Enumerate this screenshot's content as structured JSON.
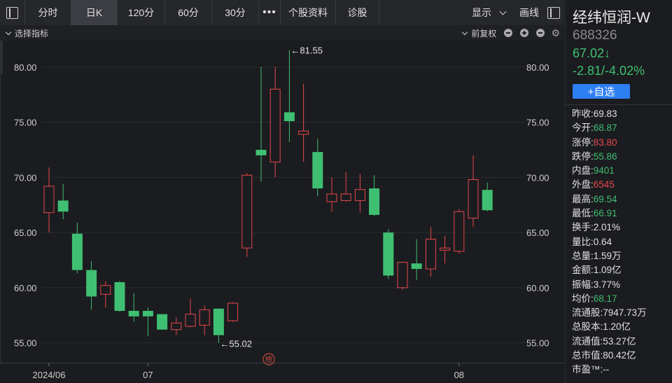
{
  "toolbar": {
    "tabs": [
      {
        "label": "分时",
        "active": false
      },
      {
        "label": "日K",
        "active": true
      },
      {
        "label": "120分",
        "active": false
      },
      {
        "label": "60分",
        "active": false
      },
      {
        "label": "30分",
        "active": false
      },
      {
        "label": "•••",
        "active": false
      },
      {
        "label": "个股资料",
        "active": false
      },
      {
        "label": "诊股",
        "active": false
      }
    ],
    "display_label": "显示",
    "draw_label": "画线"
  },
  "subbar": {
    "indicator_label": "选择指标",
    "adjust_label": "前复权"
  },
  "stock": {
    "name": "经纬恒润-W",
    "code": "688326",
    "price": "67.02↓",
    "change": "-2.81/-4.02%",
    "watch_label": "+自选",
    "stats": [
      {
        "label": "昨收:",
        "value": "69.83",
        "color": ""
      },
      {
        "label": "今开:",
        "value": "68.87",
        "color": "green"
      },
      {
        "label": "涨停:",
        "value": "83.80",
        "color": "red"
      },
      {
        "label": "跌停:",
        "value": "55.86",
        "color": "green"
      },
      {
        "label": "内盘:",
        "value": "9401",
        "color": "green"
      },
      {
        "label": "外盘:",
        "value": "6545",
        "color": "red"
      },
      {
        "label": "最高:",
        "value": "69.54",
        "color": "green"
      },
      {
        "label": "最低:",
        "value": "66.91",
        "color": "green"
      },
      {
        "label": "换手:",
        "value": "2.01%",
        "color": ""
      },
      {
        "label": "量比:",
        "value": "0.64",
        "color": ""
      },
      {
        "label": "总量:",
        "value": "1.59万",
        "color": ""
      },
      {
        "label": "金额:",
        "value": "1.09亿",
        "color": ""
      },
      {
        "label": "振幅:",
        "value": "3.77%",
        "color": ""
      },
      {
        "label": "均价:",
        "value": "68.17",
        "color": "green"
      },
      {
        "label": "流通股:",
        "value": "7947.73万",
        "color": ""
      },
      {
        "label": "总股本:",
        "value": "1.20亿",
        "color": ""
      },
      {
        "label": "流通值:",
        "value": "53.27亿",
        "color": ""
      },
      {
        "label": "总市值:",
        "value": "80.42亿",
        "color": ""
      },
      {
        "label": "市盈™:",
        "value": "--",
        "color": ""
      }
    ]
  },
  "colors": {
    "up": "#e5484d",
    "down": "#3fbf72",
    "axis_text": "#cfcfcf",
    "grid": "#2a2b2f",
    "accent": "#2d7ff2"
  },
  "chart_data": {
    "type": "candlestick",
    "y_ticks": [
      55,
      60,
      65,
      70,
      75,
      80
    ],
    "y_tick_labels": [
      "55.00",
      "60.00",
      "65.00",
      "70.00",
      "75.00",
      "80.00"
    ],
    "ylim": [
      53.2,
      82.4
    ],
    "x_labels": [
      {
        "label": "2024/06",
        "index": 0
      },
      {
        "label": "07",
        "index": 7
      },
      {
        "label": "08",
        "index": 29
      }
    ],
    "annotations": {
      "high": "←81.55",
      "low": "←55.02"
    },
    "badge": "榜",
    "candles": [
      {
        "o": 66.8,
        "h": 70.9,
        "l": 65.0,
        "c": 69.2
      },
      {
        "o": 67.9,
        "h": 69.4,
        "l": 66.2,
        "c": 66.9
      },
      {
        "o": 64.9,
        "h": 65.9,
        "l": 61.3,
        "c": 61.6
      },
      {
        "o": 61.6,
        "h": 62.4,
        "l": 58.0,
        "c": 59.2
      },
      {
        "o": 59.4,
        "h": 60.6,
        "l": 58.2,
        "c": 60.2
      },
      {
        "o": 60.5,
        "h": 60.6,
        "l": 57.8,
        "c": 57.9
      },
      {
        "o": 57.9,
        "h": 59.5,
        "l": 56.9,
        "c": 57.4
      },
      {
        "o": 57.9,
        "h": 58.2,
        "l": 55.6,
        "c": 57.4
      },
      {
        "o": 57.6,
        "h": 57.6,
        "l": 56.2,
        "c": 56.2
      },
      {
        "o": 56.2,
        "h": 57.3,
        "l": 55.7,
        "c": 56.8
      },
      {
        "o": 56.5,
        "h": 59.0,
        "l": 56.4,
        "c": 57.6
      },
      {
        "o": 56.6,
        "h": 58.4,
        "l": 55.7,
        "c": 58.0
      },
      {
        "o": 58.1,
        "h": 58.1,
        "l": 55.0,
        "c": 55.7
      },
      {
        "o": 57.0,
        "h": 58.7,
        "l": 56.9,
        "c": 58.6
      },
      {
        "o": 63.6,
        "h": 70.4,
        "l": 62.8,
        "c": 70.2
      },
      {
        "o": 72.5,
        "h": 80.0,
        "l": 69.6,
        "c": 72.0
      },
      {
        "o": 71.4,
        "h": 80.0,
        "l": 70.0,
        "c": 78.0
      },
      {
        "o": 75.9,
        "h": 81.55,
        "l": 73.2,
        "c": 75.1
      },
      {
        "o": 73.9,
        "h": 78.5,
        "l": 71.4,
        "c": 74.2
      },
      {
        "o": 72.3,
        "h": 73.5,
        "l": 68.3,
        "c": 69.0
      },
      {
        "o": 67.8,
        "h": 70.0,
        "l": 66.9,
        "c": 68.5
      },
      {
        "o": 67.9,
        "h": 70.5,
        "l": 67.8,
        "c": 68.5
      },
      {
        "o": 67.9,
        "h": 70.3,
        "l": 66.8,
        "c": 68.9
      },
      {
        "o": 69.0,
        "h": 70.2,
        "l": 66.5,
        "c": 66.6
      },
      {
        "o": 65.0,
        "h": 65.3,
        "l": 60.8,
        "c": 61.1
      },
      {
        "o": 60.0,
        "h": 62.3,
        "l": 59.8,
        "c": 62.3
      },
      {
        "o": 62.2,
        "h": 64.4,
        "l": 60.7,
        "c": 61.7
      },
      {
        "o": 61.7,
        "h": 65.5,
        "l": 61.0,
        "c": 64.4
      },
      {
        "o": 63.4,
        "h": 64.7,
        "l": 62.2,
        "c": 63.6
      },
      {
        "o": 63.3,
        "h": 67.1,
        "l": 63.1,
        "c": 66.9
      },
      {
        "o": 66.3,
        "h": 72.0,
        "l": 65.5,
        "c": 69.8
      },
      {
        "o": 68.87,
        "h": 69.54,
        "l": 66.91,
        "c": 67.02
      }
    ]
  }
}
